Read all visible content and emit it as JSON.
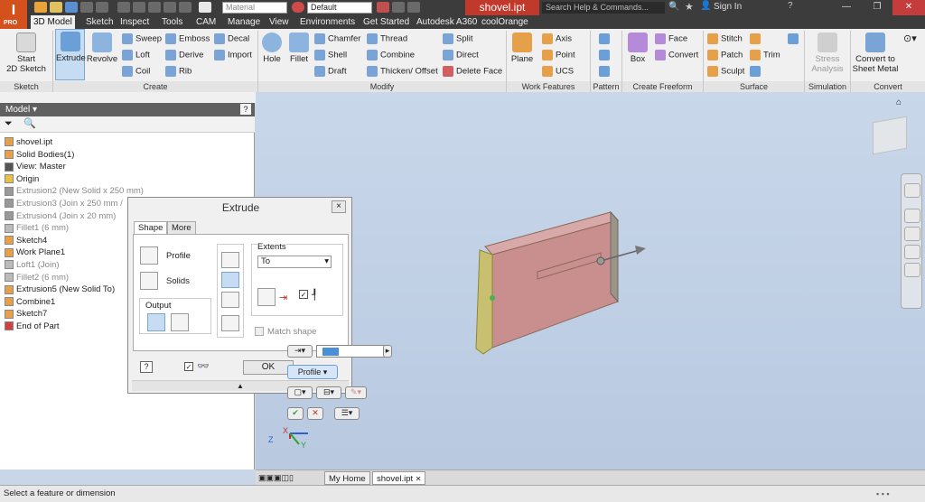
{
  "app": {
    "logo_letter": "I",
    "logo_sub": "PRO",
    "document_title": "shovel.ipt"
  },
  "quick_access": {
    "material": "Material",
    "appearance": "Default",
    "search_placeholder": "Search Help & Commands...",
    "sign_in": "Sign In"
  },
  "tabs": [
    {
      "label": "3D Model",
      "active": true
    },
    {
      "label": "Sketch"
    },
    {
      "label": "Inspect"
    },
    {
      "label": "Tools"
    },
    {
      "label": "CAM"
    },
    {
      "label": "Manage"
    },
    {
      "label": "View"
    },
    {
      "label": "Environments"
    },
    {
      "label": "Get Started"
    },
    {
      "label": "Autodesk A360"
    },
    {
      "label": "coolOrange"
    }
  ],
  "ribbon": {
    "start_sketch": "Start\n2D Sketch",
    "extrude": "Extrude",
    "revolve": "Revolve",
    "sweep": "Sweep",
    "loft": "Loft",
    "coil": "Coil",
    "emboss": "Emboss",
    "derive": "Derive",
    "rib": "Rib",
    "decal": "Decal",
    "import": "Import",
    "hole": "Hole",
    "fillet": "Fillet",
    "chamfer": "Chamfer",
    "shell": "Shell",
    "draft": "Draft",
    "thread": "Thread",
    "combine": "Combine",
    "thicken": "Thicken/ Offset",
    "split": "Split",
    "direct": "Direct",
    "delete_face": "Delete Face",
    "plane": "Plane",
    "axis": "Axis",
    "point": "Point",
    "ucs": "UCS",
    "box": "Box",
    "face": "Face",
    "convert": "Convert",
    "stitch": "Stitch",
    "patch": "Patch",
    "sculpt": "Sculpt",
    "trim": "Trim",
    "stress": "Stress\nAnalysis",
    "convert_sheet": "Convert to\nSheet Metal",
    "panels": {
      "sketch": "Sketch",
      "create": "Create",
      "modify": "Modify",
      "work_features": "Work Features",
      "pattern": "Pattern",
      "freeform": "Create Freeform",
      "surface": "Surface",
      "simulation": "Simulation",
      "convert": "Convert"
    }
  },
  "browser": {
    "title": "Model ▾",
    "items": [
      {
        "label": "shovel.ipt"
      },
      {
        "label": "Solid Bodies(1)"
      },
      {
        "label": "View: Master"
      },
      {
        "label": "Origin"
      },
      {
        "label": "Extrusion2 (New Solid x 250 mm)",
        "dim": true
      },
      {
        "label": "Extrusion3 (Join x 250 mm /",
        "dim": true
      },
      {
        "label": "Extrusion4 (Join x 20 mm)",
        "dim": true
      },
      {
        "label": "Fillet1 (6 mm)",
        "dim": true
      },
      {
        "label": "Sketch4"
      },
      {
        "label": "Work Plane1"
      },
      {
        "label": "Loft1 (Join)",
        "dim": true
      },
      {
        "label": "Fillet2 (6 mm)",
        "dim": true
      },
      {
        "label": "Extrusion5 (New Solid To)"
      },
      {
        "label": "Combine1"
      },
      {
        "label": "Sketch7"
      },
      {
        "label": "End of Part"
      }
    ]
  },
  "dialog": {
    "title": "Extrude",
    "tab_shape": "Shape",
    "tab_more": "More",
    "profile": "Profile",
    "solids": "Solids",
    "output": "Output",
    "extents": "Extents",
    "extents_value": "To",
    "match_shape": "Match shape",
    "ok": "OK",
    "close": "×"
  },
  "minitoolbar": {
    "profile": "Profile"
  },
  "doc_tabs": {
    "home": "My Home",
    "file": "shovel.ipt"
  },
  "status": "Select a feature or dimension",
  "colors": {
    "accent": "#d4511e",
    "title_red": "#c0392b",
    "part_fill": "#c98f8f",
    "part_edge": "#8a6a5a"
  }
}
